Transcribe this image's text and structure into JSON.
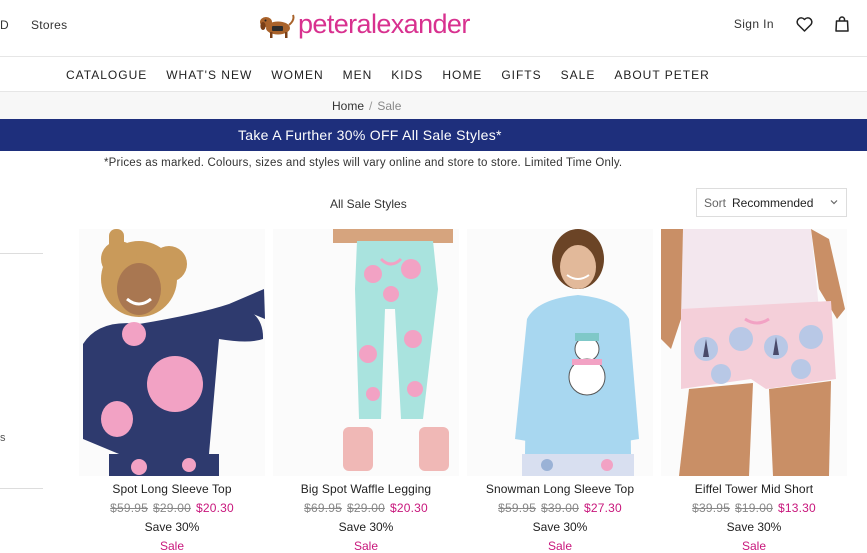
{
  "header": {
    "left_links": [
      "D",
      "Stores"
    ],
    "logo_text": "peteralexander",
    "sign_in": "Sign In"
  },
  "nav": {
    "items": [
      "CATALOGUE",
      "WHAT'S NEW",
      "WOMEN",
      "MEN",
      "KIDS",
      "HOME",
      "GIFTS",
      "SALE",
      "ABOUT PETER"
    ]
  },
  "breadcrumb": {
    "home": "Home",
    "separator": "/",
    "current": "Sale"
  },
  "promo": {
    "text": "Take A Further 30% OFF All Sale Styles*"
  },
  "disclaimer": "*Prices as marked. Colours, sizes and styles will vary online and store to store. Limited Time Only.",
  "listing": {
    "heading": "All Sale Styles",
    "sort_label": "Sort",
    "sort_value": "Recommended"
  },
  "side_fragment": "s",
  "products": [
    {
      "name": "Spot Long Sleeve Top",
      "prices": [
        "$59.95",
        "$29.00"
      ],
      "now_price": "$20.30",
      "save": "Save 30%",
      "tag": "Sale"
    },
    {
      "name": "Big Spot Waffle Legging",
      "prices": [
        "$69.95",
        "$29.00"
      ],
      "now_price": "$20.30",
      "save": "Save 30%",
      "tag": "Sale"
    },
    {
      "name": "Snowman Long Sleeve Top",
      "prices": [
        "$59.95",
        "$39.00"
      ],
      "now_price": "$27.30",
      "save": "Save 30%",
      "tag": "Sale"
    },
    {
      "name": "Eiffel Tower Mid Short",
      "prices": [
        "$39.95",
        "$19.00"
      ],
      "now_price": "$13.30",
      "save": "Save 30%",
      "tag": "Sale"
    }
  ],
  "colors": {
    "brand_pink": "#d8318f",
    "sale_pink": "#c8177c",
    "promo_navy": "#1e2f7c"
  },
  "icons": [
    "dog-logo-icon",
    "heart-icon",
    "bag-icon",
    "chevron-down-icon"
  ]
}
